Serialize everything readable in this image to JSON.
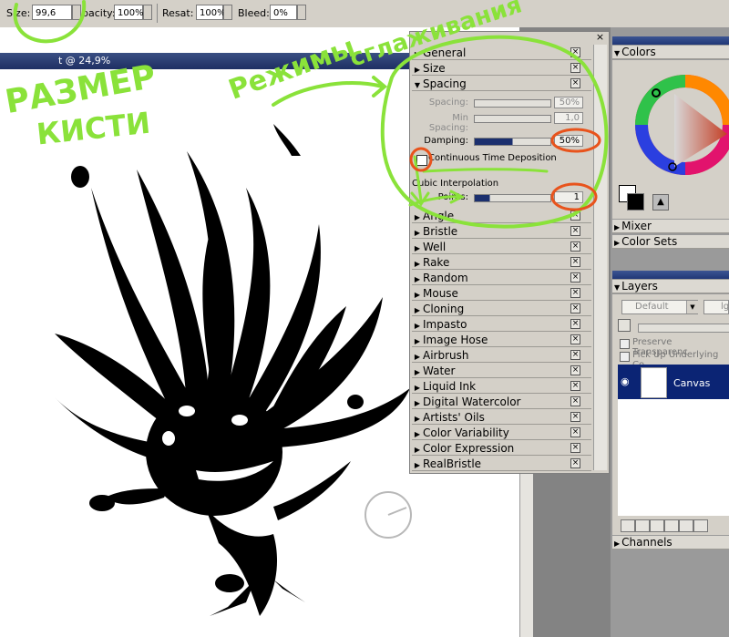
{
  "property_bar": {
    "size_label": "Size:",
    "size_value": "99,6",
    "opacity_label": "pacity:",
    "opacity_value": "100%",
    "resat_label": "Resat:",
    "resat_value": "100%",
    "bleed_label": "Bleed:",
    "bleed_value": "0%"
  },
  "document": {
    "title": "t @ 24,9%"
  },
  "brush_controls": {
    "sections_top": [
      {
        "label": "General",
        "expanded": false
      },
      {
        "label": "Size",
        "expanded": false
      },
      {
        "label": "Spacing",
        "expanded": true
      }
    ],
    "spacing": {
      "spacing_label": "Spacing:",
      "spacing_value": "50%",
      "min_spacing_label": "Min Spacing:",
      "min_spacing_value": "1,0",
      "damping_label": "Damping:",
      "damping_value": "50%",
      "continuous_label": "Continuous Time Deposition",
      "continuous_checked": false,
      "cubic_label": "Cubic Interpolation",
      "points_label": "Points:",
      "points_value": "1"
    },
    "sections_rest": [
      "Angle",
      "Bristle",
      "Well",
      "Rake",
      "Random",
      "Mouse",
      "Cloning",
      "Impasto",
      "Image Hose",
      "Airbrush",
      "Water",
      "Liquid Ink",
      "Digital Watercolor",
      "Artists' Oils",
      "Color Variability",
      "Color Expression",
      "RealBristle"
    ]
  },
  "colors_panel": {
    "title": "Colors",
    "mixer": "Mixer",
    "color_sets": "Color Sets",
    "hue_marker_color": "#e0241f"
  },
  "layers_panel": {
    "title": "Layers",
    "composite_method": "Default",
    "preserve_transparency": "Preserve Transparenc",
    "pick_up_underlying": "Pick Up Underlying Co",
    "layer_name": "Canvas",
    "channels": "Channels"
  },
  "annotations": {
    "size_caption_line1": "РАЗМЕР",
    "size_caption_line2": "КИСТИ",
    "modes_line1": "Режимы",
    "modes_line2": "сглаживания",
    "annotation_color": "#8ae23a",
    "highlight_color": "#e8531c"
  }
}
